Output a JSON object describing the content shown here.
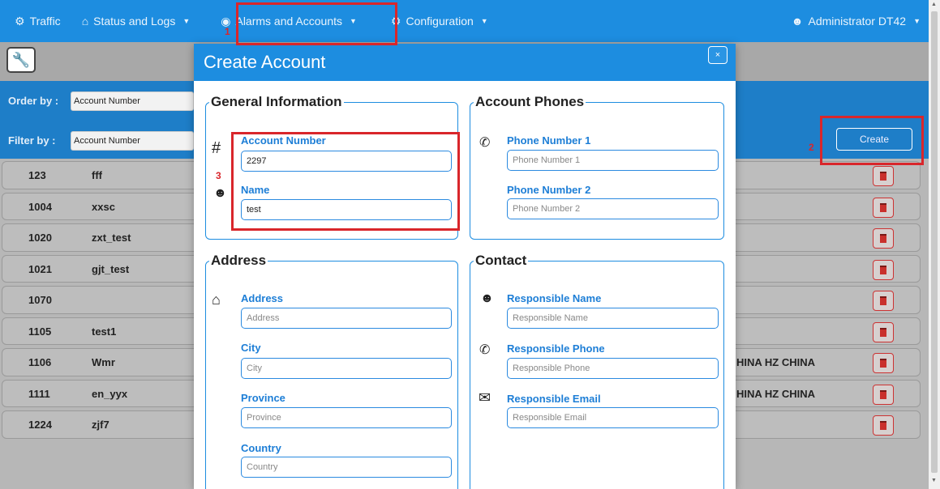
{
  "nav": {
    "traffic": "Traffic",
    "status_logs": "Status and Logs",
    "alarms_accounts": "Alarms and Accounts",
    "configuration": "Configuration",
    "user": "Administrator DT42"
  },
  "filters": {
    "order_by_label": "Order by :",
    "order_by_value": "Account Number",
    "filter_by_label": "Filter by :",
    "filter_by_value": "Account Number",
    "create_label": "Create"
  },
  "rows": [
    {
      "number": "123",
      "name": "fff",
      "extra": ""
    },
    {
      "number": "1004",
      "name": "xxsc",
      "extra": ""
    },
    {
      "number": "1020",
      "name": "zxt_test",
      "extra": ""
    },
    {
      "number": "1021",
      "name": "gjt_test",
      "extra": ""
    },
    {
      "number": "1070",
      "name": "",
      "extra": ""
    },
    {
      "number": "1105",
      "name": "test1",
      "extra": ""
    },
    {
      "number": "1106",
      "name": "Wmr",
      "extra": "HINA HZ CHINA"
    },
    {
      "number": "1111",
      "name": "en_yyx",
      "extra": "HINA HZ CHINA"
    },
    {
      "number": "1224",
      "name": "zjf7",
      "extra": ""
    }
  ],
  "modal": {
    "title": "Create Account",
    "close": "×",
    "general": {
      "legend": "General Information",
      "account_number_label": "Account Number",
      "account_number_value": "2297",
      "name_label": "Name",
      "name_value": "test",
      "hash": "#"
    },
    "phones": {
      "legend": "Account Phones",
      "phone1_label": "Phone Number 1",
      "phone1_placeholder": "Phone Number 1",
      "phone2_label": "Phone Number 2",
      "phone2_placeholder": "Phone Number 2"
    },
    "address": {
      "legend": "Address",
      "address_label": "Address",
      "address_placeholder": "Address",
      "city_label": "City",
      "city_placeholder": "City",
      "province_label": "Province",
      "province_placeholder": "Province",
      "country_label": "Country",
      "country_placeholder": "Country"
    },
    "contact": {
      "legend": "Contact",
      "resp_name_label": "Responsible Name",
      "resp_name_placeholder": "Responsible Name",
      "resp_phone_label": "Responsible Phone",
      "resp_phone_placeholder": "Responsible Phone",
      "resp_email_label": "Responsible Email",
      "resp_email_placeholder": "Responsible Email"
    }
  },
  "annotations": {
    "n1": "1",
    "n2": "2",
    "n3": "3"
  },
  "colors": {
    "primary": "#1d8de0",
    "annotation": "#d9262b",
    "delete": "#c9302c"
  }
}
